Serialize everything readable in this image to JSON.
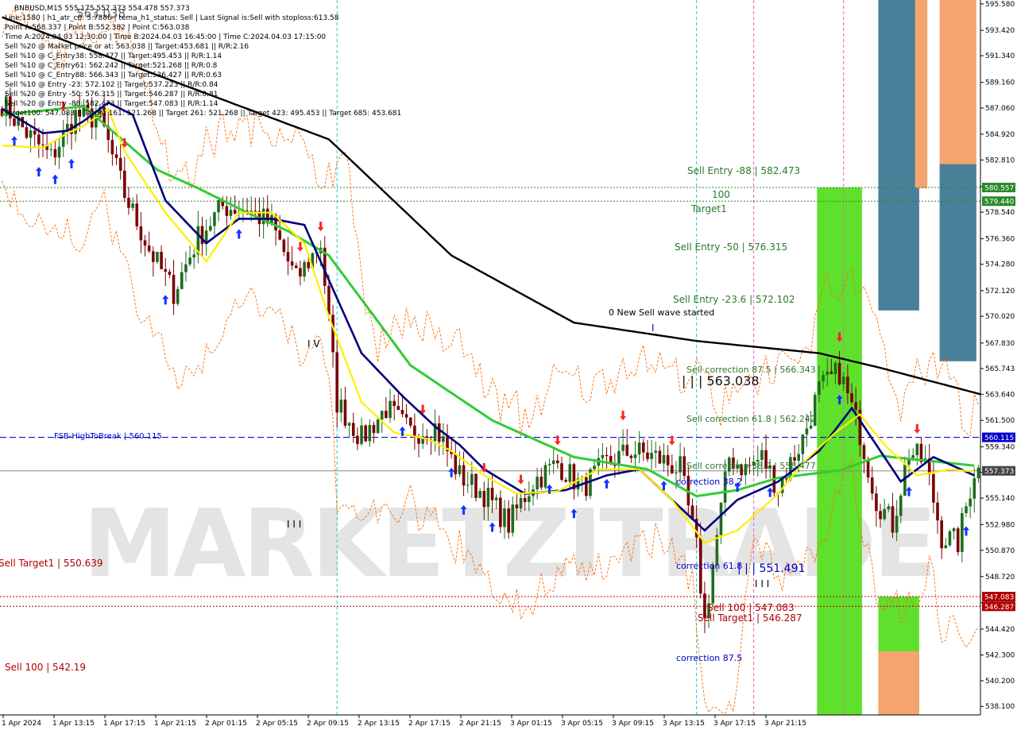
{
  "colors": {
    "background": "#ffffff",
    "bull": "#1f6b1f",
    "bear": "#7a0000",
    "ma_black": "#000000",
    "ma_green": "#33cc33",
    "ma_navy": "#00007a",
    "ma_yellow": "#ffee00",
    "envelope": "#ff6a00",
    "zone_green": "#5fe02c",
    "zone_blue": "#4a7f99",
    "zone_orange": "#f4a46e",
    "label_green": "#3c8a3c",
    "label_red": "#b00000",
    "label_blue": "#0000cc",
    "hline_blue": "#0000cc",
    "hline_green": "#2a8a2a",
    "hline_red": "#b00000",
    "vline_cyan": "#22cccc",
    "vline_magenta": "#e060c0",
    "watermark": "#d0d0d0",
    "arrow_blue": "#1133ff",
    "arrow_red": "#ff2222"
  },
  "header": {
    "lines": [
      "BNBUSD,M15  555.175 557.373 554.478 557.373",
      "Line:1580 | h1_atr_c0: 5.7886 | tema_h1_status: Sell | Last Signal is:Sell with stoploss:613.58",
      "Point A:568.337 | Point B:552.382 | Point C:563.038",
      "Time A:2024.04.03 12:30:00 | Time B:2024.04.03 16:45:00 | Time C:2024.04.03 17:15:00",
      "Sell %20 @ Market price or at: 563.038 || Target:453.681 || R/R:2.16",
      "Sell %10 @ C_Entry38: 558.477 || Target:495.453 || R/R:1.14",
      "Sell %10 @ C_Entry61: 562.242 || Target:521.268 || R/R:0.8",
      "Sell %10 @ C_Entry88: 566.343 || Target:536.427 || R/R:0.63",
      "Sell %10 @ Entry -23: 572.102 || Target:537.223 || R/R:0.84",
      "Sell %20 @ Entry -50: 576.315 || Target:546.287 || R/R:0.81",
      "Sell %20 @ Entry -88: 582.473 || Target:547.083 || R/R:1.14",
      "Target100: 547.083 || Target 161: 521.268 || Target 261: 521.268 || Target 423: 495.453 || Target 685: 453.681"
    ],
    "big_price": "563.038"
  },
  "watermark": "MARKETZITRADE",
  "price_scale": {
    "min": 537.4,
    "max": 595.9,
    "ticks": [
      "538.100",
      "540.200",
      "542.300",
      "544.420",
      "546.580",
      "548.720",
      "550.870",
      "552.980",
      "555.140",
      "557.250",
      "559.340",
      "561.500",
      "563.640",
      "565.743",
      "567.830",
      "570.020",
      "572.120",
      "574.280",
      "576.360",
      "578.540",
      "580.650",
      "582.810",
      "584.920",
      "587.060",
      "589.160",
      "591.340",
      "593.420",
      "595.580"
    ]
  },
  "time_scale": [
    "1 Apr 2024",
    "1 Apr 13:15",
    "1 Apr 17:15",
    "1 Apr 21:15",
    "2 Apr 01:15",
    "2 Apr 05:15",
    "2 Apr 09:15",
    "2 Apr 13:15",
    "2 Apr 17:15",
    "2 Apr 21:15",
    "3 Apr 01:15",
    "3 Apr 05:15",
    "3 Apr 09:15",
    "3 Apr 13:15",
    "3 Apr 17:15",
    "3 Apr 21:15"
  ],
  "price_tags": [
    {
      "value": "580.557",
      "price": 580.557,
      "color": "#2a8a2a"
    },
    {
      "value": "579.440",
      "price": 579.44,
      "color": "#2a8a2a"
    },
    {
      "value": "560.115",
      "price": 560.115,
      "color": "#0000cc"
    },
    {
      "value": "557.373",
      "price": 557.373,
      "color": "#444444"
    },
    {
      "value": "547.083",
      "price": 547.083,
      "color": "#b00000"
    },
    {
      "value": "546.287",
      "price": 546.287,
      "color": "#b00000"
    }
  ],
  "annotations": {
    "fsb": "FSB-HighToBreak | 560.115",
    "sell_target1_left": "Sell Target1 | 550.639",
    "sell_100_left": "Sell 100 | 542.19",
    "sell_entry_88": "Sell Entry -88 | 582.473",
    "label_100": "100",
    "target1": "Target1",
    "sell_entry_50": "Sell Entry -50 | 576.315",
    "sell_entry_23": "Sell Entry -23.6 | 572.102",
    "new_wave": "0 New Sell wave started",
    "sell_corr_875": "Sell correction 87.5 | 566.343",
    "sell_corr_618": "Sell correction 61.8 | 562.242",
    "sell_corr_382": "Sell correction 38.2 | 558.477",
    "big_price": "| | | 563.038",
    "correction_382": "correction 38.2",
    "correction_618": "correction 61.8",
    "low_price": "| | | 551.491",
    "sell_100": "Sell 100 | 547.083",
    "sell_target1": "Sell Target1 | 546.287",
    "correction_875": "correction 87.5",
    "marker_iv": "I V",
    "marker_iii_a": "I I I",
    "marker_iii_b": "I I I",
    "marker_i": "I"
  },
  "chart_data": {
    "type": "candlestick",
    "title": "BNBUSD,M15",
    "timeframe": "M15",
    "last_price": 557.373,
    "ylim": [
      537.4,
      595.9
    ],
    "x_labels": [
      "1 Apr 2024",
      "1 Apr 13:15",
      "1 Apr 17:15",
      "1 Apr 21:15",
      "2 Apr 01:15",
      "2 Apr 05:15",
      "2 Apr 09:15",
      "2 Apr 13:15",
      "2 Apr 17:15",
      "2 Apr 21:15",
      "3 Apr 01:15",
      "3 Apr 05:15",
      "3 Apr 09:15",
      "3 Apr 13:15",
      "3 Apr 17:15",
      "3 Apr 21:15"
    ],
    "close_path": [
      [
        0,
        587.5
      ],
      [
        6,
        585.0
      ],
      [
        12,
        583.0
      ],
      [
        18,
        586.5
      ],
      [
        24,
        586.2
      ],
      [
        30,
        580.0
      ],
      [
        36,
        575.5
      ],
      [
        42,
        572.0
      ],
      [
        48,
        576.5
      ],
      [
        54,
        579.0
      ],
      [
        60,
        578.8
      ],
      [
        66,
        577.5
      ],
      [
        72,
        573.0
      ],
      [
        78,
        576.0
      ],
      [
        82,
        563.0
      ],
      [
        88,
        560.0
      ],
      [
        94,
        562.5
      ],
      [
        100,
        560.5
      ],
      [
        106,
        561.0
      ],
      [
        112,
        557.0
      ],
      [
        118,
        555.5
      ],
      [
        124,
        553.0
      ],
      [
        130,
        556.5
      ],
      [
        136,
        558.0
      ],
      [
        142,
        556.0
      ],
      [
        148,
        558.0
      ],
      [
        154,
        559.0
      ],
      [
        160,
        558.5
      ],
      [
        166,
        557.5
      ],
      [
        170,
        551.0
      ],
      [
        172,
        545.0
      ],
      [
        175,
        552.0
      ],
      [
        178,
        558.5
      ],
      [
        182,
        557.5
      ],
      [
        186,
        558.5
      ],
      [
        190,
        556.0
      ],
      [
        196,
        560.0
      ],
      [
        200,
        564.0
      ],
      [
        205,
        565.5
      ],
      [
        210,
        560.5
      ],
      [
        214,
        555.0
      ],
      [
        218,
        553.0
      ],
      [
        222,
        559.0
      ],
      [
        226,
        558.0
      ],
      [
        230,
        552.0
      ],
      [
        234,
        551.5
      ],
      [
        238,
        557.4
      ]
    ],
    "bar_count": 240,
    "moving_averages": [
      {
        "name": "black",
        "color": "#000000",
        "points": [
          [
            0,
            594.5
          ],
          [
            40,
            589.5
          ],
          [
            80,
            584.5
          ],
          [
            110,
            575.0
          ],
          [
            140,
            569.5
          ],
          [
            170,
            568.0
          ],
          [
            200,
            567.0
          ],
          [
            215,
            565.8
          ],
          [
            240,
            563.6
          ]
        ]
      },
      {
        "name": "green",
        "color": "#33cc33",
        "points": [
          [
            0,
            586.5
          ],
          [
            20,
            587.2
          ],
          [
            38,
            582.0
          ],
          [
            48,
            580.5
          ],
          [
            60,
            578.5
          ],
          [
            70,
            577.0
          ],
          [
            80,
            575.0
          ],
          [
            100,
            566.0
          ],
          [
            120,
            561.5
          ],
          [
            140,
            558.5
          ],
          [
            158,
            557.5
          ],
          [
            170,
            555.3
          ],
          [
            180,
            555.8
          ],
          [
            190,
            556.8
          ],
          [
            205,
            557.4
          ],
          [
            215,
            558.6
          ],
          [
            238,
            557.8
          ]
        ]
      },
      {
        "name": "navy",
        "color": "#00007a",
        "points": [
          [
            0,
            587.0
          ],
          [
            10,
            585.0
          ],
          [
            16,
            585.2
          ],
          [
            20,
            586.0
          ],
          [
            26,
            587.5
          ],
          [
            32,
            586.5
          ],
          [
            40,
            579.5
          ],
          [
            50,
            576.0
          ],
          [
            58,
            578.0
          ],
          [
            66,
            578.0
          ],
          [
            74,
            577.5
          ],
          [
            80,
            573.0
          ],
          [
            88,
            567.0
          ],
          [
            98,
            563.5
          ],
          [
            106,
            561.0
          ],
          [
            112,
            559.5
          ],
          [
            118,
            557.5
          ],
          [
            128,
            555.5
          ],
          [
            138,
            555.8
          ],
          [
            148,
            557.0
          ],
          [
            156,
            557.5
          ],
          [
            164,
            555.0
          ],
          [
            172,
            552.5
          ],
          [
            180,
            555.0
          ],
          [
            190,
            556.5
          ],
          [
            200,
            559.0
          ],
          [
            208,
            562.5
          ],
          [
            214,
            559.5
          ],
          [
            220,
            556.5
          ],
          [
            228,
            558.5
          ],
          [
            238,
            557.0
          ]
        ]
      },
      {
        "name": "yellow",
        "color": "#ffee00",
        "points": [
          [
            0,
            584.0
          ],
          [
            10,
            583.8
          ],
          [
            16,
            585.0
          ],
          [
            20,
            585.6
          ],
          [
            26,
            587.0
          ],
          [
            30,
            583.5
          ],
          [
            40,
            578.5
          ],
          [
            50,
            574.5
          ],
          [
            58,
            578.5
          ],
          [
            66,
            578.5
          ],
          [
            74,
            576.0
          ],
          [
            80,
            570.0
          ],
          [
            88,
            563.0
          ],
          [
            96,
            560.5
          ],
          [
            104,
            560.0
          ],
          [
            110,
            559.0
          ],
          [
            118,
            557.0
          ],
          [
            126,
            555.5
          ],
          [
            136,
            555.7
          ],
          [
            146,
            557.5
          ],
          [
            156,
            557.5
          ],
          [
            164,
            555.0
          ],
          [
            172,
            551.5
          ],
          [
            180,
            552.5
          ],
          [
            190,
            555.5
          ],
          [
            196,
            558.0
          ],
          [
            204,
            560.5
          ],
          [
            210,
            562.0
          ],
          [
            216,
            559.5
          ],
          [
            224,
            557.0
          ],
          [
            232,
            557.5
          ],
          [
            238,
            557.3
          ]
        ]
      }
    ],
    "horizontal_levels": [
      {
        "name": "fsb_high_to_break",
        "price": 560.115,
        "style": "dashed",
        "color": "#0000cc"
      },
      {
        "name": "level_580",
        "price": 580.557,
        "style": "dotted",
        "color": "#2a8a2a"
      },
      {
        "name": "level_579",
        "price": 579.44,
        "style": "dotted",
        "color": "#2a8a2a"
      },
      {
        "name": "level_547",
        "price": 547.083,
        "style": "dotted",
        "color": "#b00000"
      },
      {
        "name": "level_546",
        "price": 546.287,
        "style": "dotted",
        "color": "#b00000"
      },
      {
        "name": "last_price",
        "price": 557.373,
        "style": "solid",
        "color": "#888888"
      }
    ],
    "vertical_lines": [
      {
        "bar": 82,
        "color": "#22cccc"
      },
      {
        "bar": 170,
        "color": "#22cccc"
      },
      {
        "bar": 184,
        "color": "#e060c0"
      },
      {
        "bar": 206,
        "color": "#e060c0"
      }
    ],
    "zones": [
      {
        "from_bar": 200,
        "to_bar": 211,
        "top": 580.557,
        "bottom": 537.4,
        "color": "#5fe02c"
      },
      {
        "from_bar": 215,
        "to_bar": 225,
        "top": 595.9,
        "bottom": 570.5,
        "color": "#4a7f99"
      },
      {
        "from_bar": 224,
        "to_bar": 227,
        "top": 595.9,
        "bottom": 580.5,
        "color": "#f4a46e"
      },
      {
        "from_bar": 230,
        "to_bar": 239,
        "top": 595.9,
        "bottom": 582.473,
        "color": "#f4a46e"
      },
      {
        "from_bar": 230,
        "to_bar": 239,
        "top": 582.473,
        "bottom": 566.343,
        "color": "#4a7f99"
      },
      {
        "from_bar": 244,
        "to_bar": 253,
        "top": 595.9,
        "bottom": 582.473,
        "color": "#f4a46e"
      },
      {
        "from_bar": 244,
        "to_bar": 253,
        "top": 582.473,
        "bottom": 547.083,
        "color": "#5fe02c"
      },
      {
        "from_bar": 215,
        "to_bar": 225,
        "top": 547.083,
        "bottom": 537.4,
        "color": "#5fe02c"
      },
      {
        "from_bar": 215,
        "to_bar": 225,
        "top": 542.6,
        "bottom": 537.4,
        "color": "#f4a46e"
      }
    ]
  }
}
